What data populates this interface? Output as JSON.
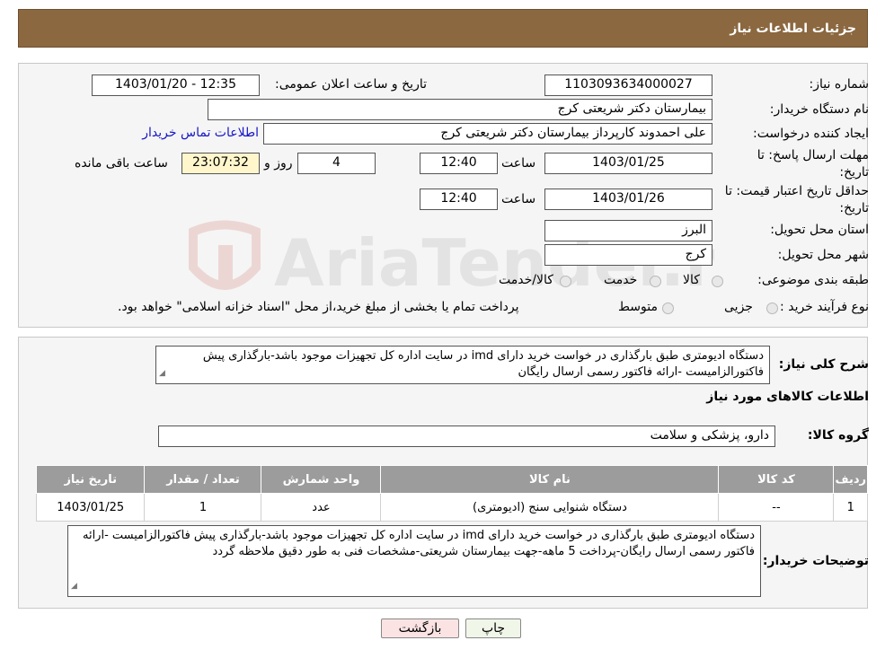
{
  "header": {
    "title": "جزئیات اطلاعات نیاز"
  },
  "need": {
    "number_label": "شماره نیاز:",
    "number_value": "1103093634000027",
    "announce_label": "تاریخ و ساعت اعلان عمومی:",
    "announce_value": "1403/01/20 - 12:35",
    "buyer_label": "نام دستگاه خریدار:",
    "buyer_value": "بیمارستان دکتر شریعتی کرج",
    "creator_label": "ایجاد کننده درخواست:",
    "creator_value": "علی احمدوند کارپرداز بیمارستان دکتر شریعتی کرج",
    "contact_link": "اطلاعات تماس خریدار",
    "deadline_label_1": "مهلت ارسال پاسخ: تا",
    "deadline_label_2": "تاریخ:",
    "deadline_date": "1403/01/25",
    "time_label": "ساعت",
    "deadline_time": "12:40",
    "days_value": "4",
    "days_label": "روز و",
    "remaining_value": "23:07:32",
    "remaining_label": "ساعت باقی مانده",
    "validity_label_1": "حداقل تاریخ اعتبار قیمت: تا",
    "validity_label_2": "تاریخ:",
    "validity_date": "1403/01/26",
    "validity_time_label": "ساعت",
    "validity_time": "12:40",
    "province_label": "استان محل تحویل:",
    "province_value": "البرز",
    "city_label": "شهر محل تحویل:",
    "city_value": "کرج",
    "category_label": "طبقه بندی موضوعی:",
    "category_options": [
      "کالا",
      "خدمت",
      "کالا/خدمت"
    ],
    "process_label": "نوع فرآیند خرید :",
    "process_options": [
      "جزیی",
      "متوسط"
    ],
    "process_note": "پرداخت تمام یا بخشی از مبلغ خرید،از محل \"اسناد خزانه اسلامی\" خواهد بود."
  },
  "description": {
    "label": "شرح کلی نیاز:",
    "text": "دستگاه ادیومتری طبق بارگذاری در خواست خرید دارای imd در سایت اداره کل تجهیزات موجود باشد-بارگذاری پیش فاکتورالزامیست -ارائه فاکتور رسمی ارسال رایگان"
  },
  "goods": {
    "section_title": "اطلاعات کالاهای مورد نیاز",
    "group_label": "گروه کالا:",
    "group_value": "دارو، پزشکی و سلامت",
    "columns": [
      "ردیف",
      "کد کالا",
      "نام کالا",
      "واحد شمارش",
      "تعداد / مقدار",
      "تاریخ نیاز"
    ],
    "rows": [
      [
        "1",
        "--",
        "دستگاه شنوایی سنج (ادیومتری)",
        "عدد",
        "1",
        "1403/01/25"
      ]
    ]
  },
  "buyer_notes": {
    "label": "توضیحات خریدار:",
    "text": "دستگاه ادیومتری طبق بارگذاری در خواست خرید دارای imd در سایت اداره کل تجهیزات موجود باشد-بارگذاری پیش فاکتورالزامیست -ارائه فاکتور رسمی ارسال رایگان-پرداخت 5 ماهه-جهت بیمارستان شریعتی-مشخصات فنی به طور دقیق ملاحظه گردد"
  },
  "buttons": {
    "print": "چاپ",
    "back": "بازگشت"
  },
  "watermark": {
    "text": "AriaTender.neT"
  }
}
